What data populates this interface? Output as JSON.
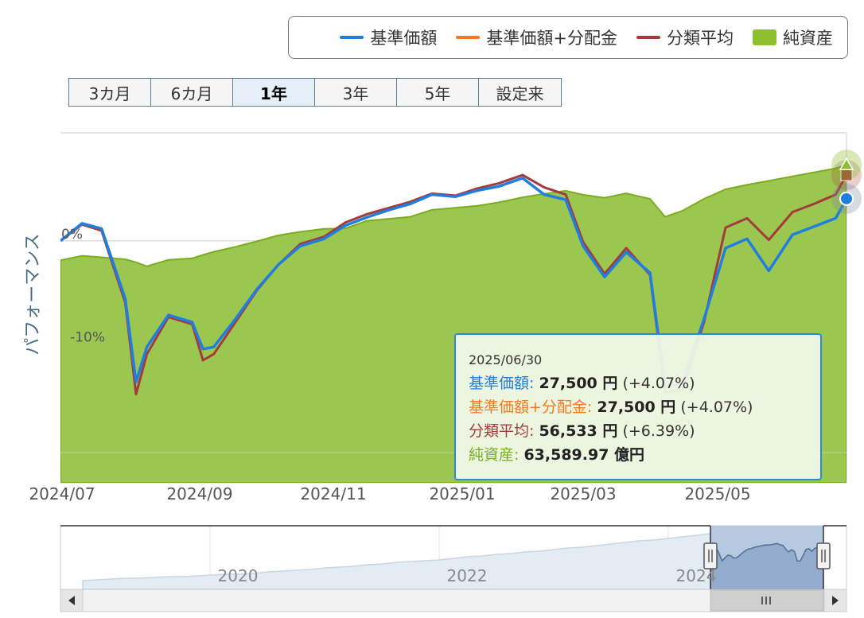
{
  "legend": [
    {
      "label": "基準価額",
      "color": "#1f7ee0",
      "shape": "line"
    },
    {
      "label": "基準価額+分配金",
      "color": "#f47920",
      "shape": "line"
    },
    {
      "label": "分類平均",
      "color": "#a33b3b",
      "shape": "line"
    },
    {
      "label": "純資産",
      "color": "#8dbf2e",
      "shape": "box"
    }
  ],
  "range_buttons": [
    {
      "label": "3カ月",
      "active": false
    },
    {
      "label": "6カ月",
      "active": false
    },
    {
      "label": "1年",
      "active": true
    },
    {
      "label": "3年",
      "active": false
    },
    {
      "label": "5年",
      "active": false
    },
    {
      "label": "設定来",
      "active": false
    }
  ],
  "tooltip": {
    "date": "2025/06/30",
    "nav_label": "基準価額:",
    "nav_value": "27,500 円",
    "nav_change": "(+4.07%)",
    "navdist_label": "基準価額+分配金:",
    "navdist_value": "27,500 円",
    "navdist_change": "(+4.07%)",
    "avg_label": "分類平均:",
    "avg_value": "56,533 円",
    "avg_change": "(+6.39%)",
    "aum_label": "純資産:",
    "aum_value": "63,589.97 億円",
    "nav_color": "#1f7ee0",
    "navdist_color": "#f47920",
    "avg_color": "#a33b3b",
    "aum_color": "#7aad1e"
  },
  "navigator": {
    "x_ticks": [
      "2020",
      "2022",
      "2024"
    ]
  },
  "colors": {
    "nav": "#1f7ee0",
    "avg": "#a33b3b",
    "aum": "#8dbf2e",
    "grid": "#cccccc"
  },
  "chart_data": {
    "type": "line",
    "ylabel": "パフォーマンス",
    "y_tick_labels": [
      "0%",
      "-10%"
    ],
    "ylim": [
      -23.5,
      10.5
    ],
    "x_tick_labels": [
      "2024/07",
      "2024/09",
      "2024/11",
      "2025/01",
      "2025/03",
      "2025/05"
    ],
    "x": [
      "2024/07/01",
      "2024/07/11",
      "2024/07/20",
      "2024/07/31",
      "2024/08/05",
      "2024/08/10",
      "2024/08/20",
      "2024/08/31",
      "2024/09/05",
      "2024/09/10",
      "2024/09/20",
      "2024/09/30",
      "2024/10/10",
      "2024/10/20",
      "2024/10/31",
      "2024/11/10",
      "2024/11/20",
      "2024/11/30",
      "2024/12/10",
      "2024/12/20",
      "2024/12/31",
      "2025/01/10",
      "2025/01/20",
      "2025/01/31",
      "2025/02/10",
      "2025/02/20",
      "2025/02/28",
      "2025/03/10",
      "2025/03/20",
      "2025/03/31",
      "2025/04/07",
      "2025/04/15",
      "2025/04/25",
      "2025/05/05",
      "2025/05/15",
      "2025/05/25",
      "2025/06/05",
      "2025/06/15",
      "2025/06/25",
      "2025/06/30"
    ],
    "series": [
      {
        "name": "基準価額",
        "values": [
          0.0,
          1.7,
          1.2,
          -5.6,
          -13.7,
          -10.3,
          -7.2,
          -7.9,
          -10.5,
          -10.3,
          -7.6,
          -4.7,
          -2.3,
          -0.5,
          0.2,
          1.5,
          2.3,
          3.0,
          3.6,
          4.5,
          4.3,
          4.9,
          5.3,
          6.1,
          4.5,
          4.0,
          -0.5,
          -3.5,
          -1.1,
          -3.1,
          -14.1,
          -13.8,
          -7.6,
          -0.7,
          0.2,
          -2.9,
          0.6,
          1.4,
          2.2,
          4.1
        ]
      },
      {
        "name": "基準価額+分配金",
        "values": [
          0.0,
          1.7,
          1.2,
          -5.6,
          -13.7,
          -10.3,
          -7.2,
          -7.9,
          -10.5,
          -10.3,
          -7.6,
          -4.7,
          -2.3,
          -0.5,
          0.2,
          1.5,
          2.3,
          3.0,
          3.6,
          4.5,
          4.3,
          4.9,
          5.3,
          6.1,
          4.5,
          4.0,
          -0.5,
          -3.5,
          -1.1,
          -3.1,
          -14.1,
          -13.8,
          -7.6,
          -0.7,
          0.2,
          -2.9,
          0.6,
          1.4,
          2.2,
          4.1
        ]
      },
      {
        "name": "分類平均",
        "values": [
          0.0,
          1.6,
          1.0,
          -6.0,
          -14.9,
          -11.0,
          -7.4,
          -8.1,
          -11.6,
          -11.0,
          -7.9,
          -4.8,
          -2.3,
          -0.3,
          0.4,
          1.8,
          2.6,
          3.2,
          3.8,
          4.6,
          4.4,
          5.1,
          5.6,
          6.4,
          5.2,
          4.5,
          -0.1,
          -3.2,
          -0.7,
          -3.3,
          -14.7,
          -14.5,
          -7.9,
          1.3,
          2.2,
          0.1,
          2.8,
          3.6,
          4.5,
          6.4
        ]
      },
      {
        "name": "純資産",
        "axis": "secondary",
        "ylim": [
          0,
          70000
        ],
        "values": [
          44500,
          45400,
          45100,
          44700,
          44100,
          43300,
          44600,
          44900,
          45600,
          46200,
          47200,
          48300,
          49500,
          50200,
          50800,
          50900,
          52400,
          52800,
          53200,
          54600,
          55000,
          55400,
          56100,
          57100,
          57800,
          58400,
          57600,
          57000,
          57900,
          56800,
          53200,
          54400,
          56800,
          58700,
          59600,
          60400,
          61300,
          62100,
          62900,
          63590
        ]
      }
    ]
  }
}
